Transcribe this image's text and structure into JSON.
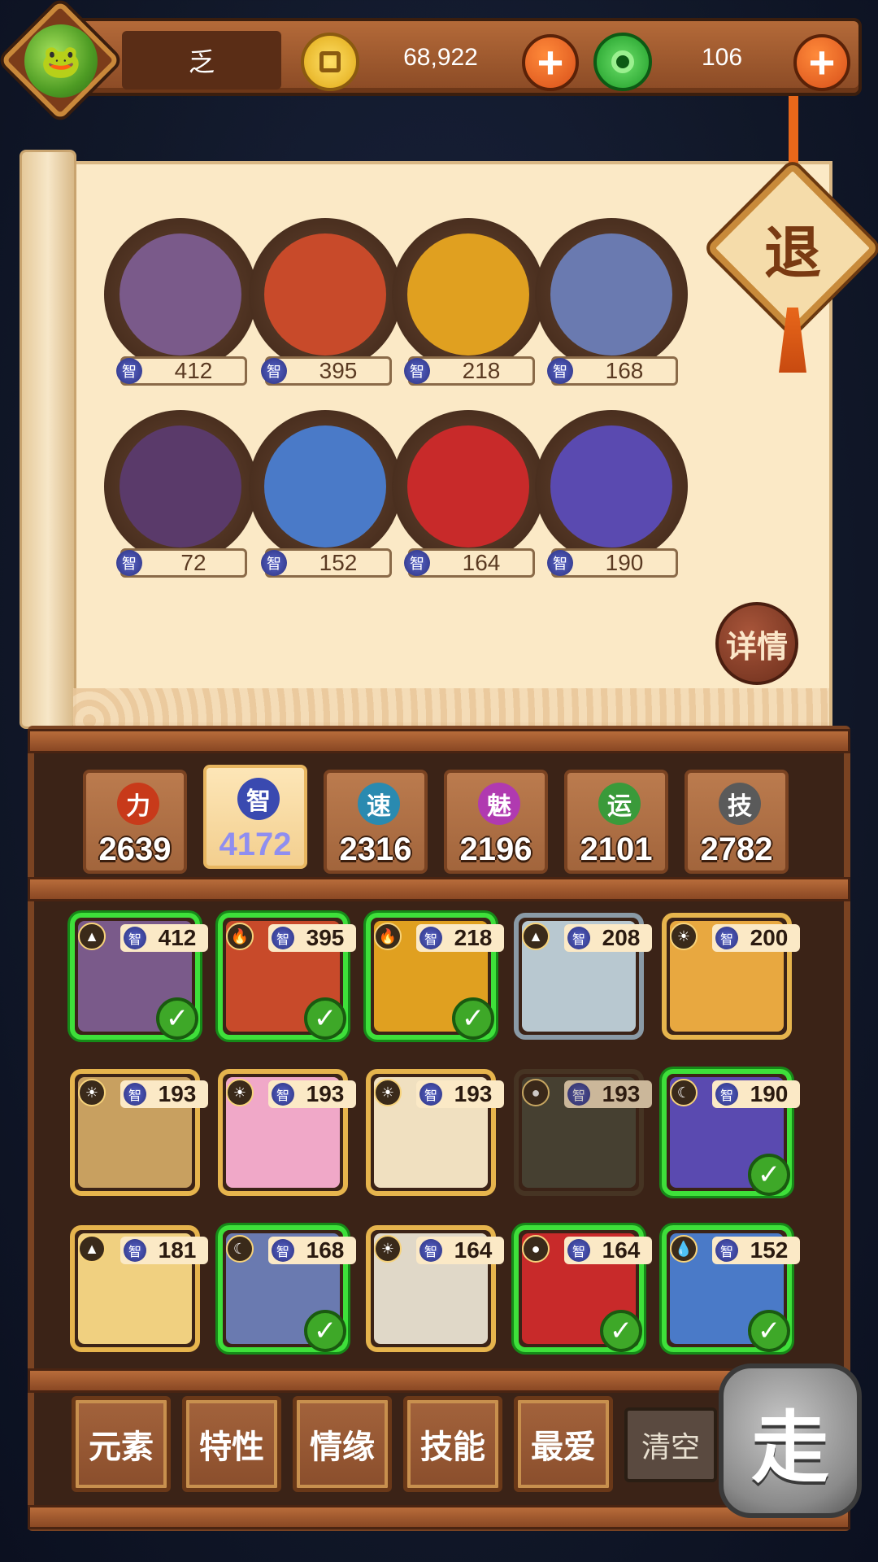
{
  "topbar": {
    "player_name": "乏",
    "gold": "68,922",
    "jade": "106",
    "plus": "+"
  },
  "scroll": {
    "retreat_label": "退",
    "detail_label": "详情",
    "stat_icon_label": "智",
    "team": [
      {
        "value": "412",
        "icon": "robots-duo",
        "bg": "#7a5a8a"
      },
      {
        "value": "395",
        "icon": "megaphone-hero",
        "bg": "#c84a2a"
      },
      {
        "value": "218",
        "icon": "fire-warrior",
        "bg": "#e0a020"
      },
      {
        "value": "168",
        "icon": "lasso-rider",
        "bg": "#6a7ab0"
      },
      {
        "value": "72",
        "icon": "bearded-sage",
        "bg": "#5a3a6a"
      },
      {
        "value": "152",
        "icon": "fox-spirit",
        "bg": "#4a7ac8"
      },
      {
        "value": "164",
        "icon": "red-monkey",
        "bg": "#c82a2a"
      },
      {
        "value": "190",
        "icon": "purple-flame",
        "bg": "#5a4ab0"
      }
    ]
  },
  "tabs": [
    {
      "label": "力",
      "value": "2639",
      "color": "#c83a1a",
      "active": false
    },
    {
      "label": "智",
      "value": "4172",
      "color": "#3a4ab0",
      "active": true
    },
    {
      "label": "速",
      "value": "2316",
      "color": "#2a8ab0",
      "active": false
    },
    {
      "label": "魅",
      "value": "2196",
      "color": "#b03ab0",
      "active": false
    },
    {
      "label": "运",
      "value": "2101",
      "color": "#3a9a3a",
      "active": false
    },
    {
      "label": "技",
      "value": "2782",
      "color": "#5a5a5a",
      "active": false
    }
  ],
  "cards": [
    {
      "value": "412",
      "elem": "▲",
      "state": "sel",
      "bg": "#7a5a8a",
      "check": "✓"
    },
    {
      "value": "395",
      "elem": "🔥",
      "state": "sel",
      "bg": "#c84a2a",
      "check": "✓"
    },
    {
      "value": "218",
      "elem": "🔥",
      "state": "sel",
      "bg": "#e0a020",
      "check": "✓"
    },
    {
      "value": "208",
      "elem": "▲",
      "state": "grey",
      "bg": "#b8c8d0",
      "check": ""
    },
    {
      "value": "200",
      "elem": "☀",
      "state": "gold",
      "bg": "#e8a840",
      "check": ""
    },
    {
      "value": "193",
      "elem": "☀",
      "state": "gold",
      "bg": "#c8a060",
      "check": ""
    },
    {
      "value": "193",
      "elem": "☀",
      "state": "gold",
      "bg": "#f0a8c8",
      "check": ""
    },
    {
      "value": "193",
      "elem": "☀",
      "state": "gold",
      "bg": "#f0e0c0",
      "check": ""
    },
    {
      "value": "193",
      "elem": "●",
      "state": "dim",
      "bg": "#4a4a3a",
      "check": ""
    },
    {
      "value": "190",
      "elem": "☾",
      "state": "sel",
      "bg": "#5a4ab0",
      "check": "✓"
    },
    {
      "value": "181",
      "elem": "▲",
      "state": "gold",
      "bg": "#f0d080",
      "check": ""
    },
    {
      "value": "168",
      "elem": "☾",
      "state": "sel",
      "bg": "#6a7ab0",
      "check": "✓"
    },
    {
      "value": "164",
      "elem": "☀",
      "state": "gold",
      "bg": "#e0d8c8",
      "check": ""
    },
    {
      "value": "164",
      "elem": "●",
      "state": "sel",
      "bg": "#c82a2a",
      "check": "✓"
    },
    {
      "value": "152",
      "elem": "💧",
      "state": "sel",
      "bg": "#4a7ac8",
      "check": "✓"
    }
  ],
  "filters": [
    "元素",
    "特性",
    "情缘",
    "技能",
    "最爱"
  ],
  "clear_label": "清空",
  "go_label": "走"
}
